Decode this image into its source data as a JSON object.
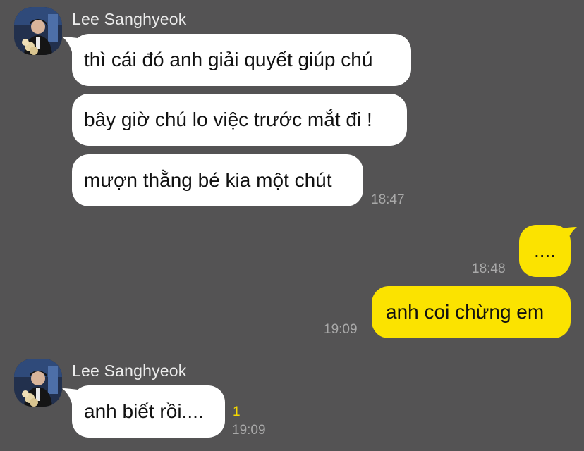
{
  "chat": {
    "groups": [
      {
        "sender": "Lee Sanghyeok",
        "avatar_icon": "profile-photo",
        "messages": [
          "thì cái đó anh giải quyết giúp chú",
          "bây giờ chú lo việc trước mắt đi !",
          "mượn thằng bé kia một chút"
        ],
        "time": "18:47"
      },
      {
        "sender": "me",
        "messages": [
          {
            "text": "....",
            "time": "18:48"
          },
          {
            "text": "anh coi chừng em",
            "time": "19:09"
          }
        ]
      },
      {
        "sender": "Lee Sanghyeok",
        "avatar_icon": "profile-photo",
        "messages": [
          "anh biết rồi...."
        ],
        "unread_count": "1",
        "time": "19:09"
      }
    ]
  },
  "colors": {
    "background": "#545354",
    "incoming_bubble": "#ffffff",
    "outgoing_bubble": "#fbe300",
    "unread": "#f5d800"
  }
}
